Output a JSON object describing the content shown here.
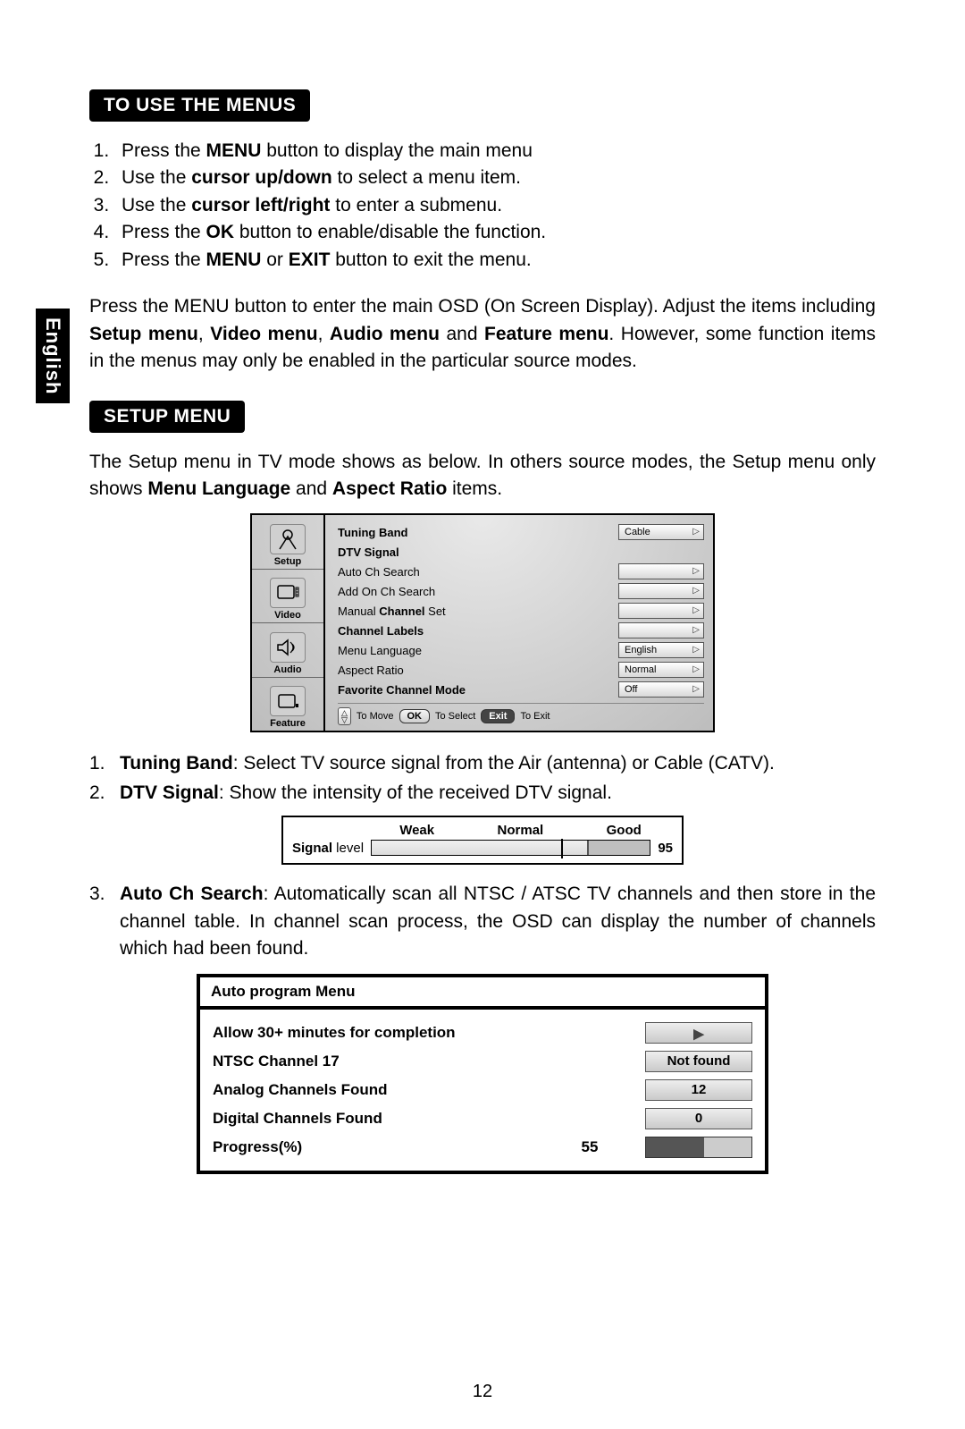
{
  "language_tab": "English",
  "heading1": "TO USE THE MENUS",
  "steps": [
    {
      "pre": "Press the ",
      "b": "MENU",
      "post": " button to display the main menu"
    },
    {
      "pre": "Use the ",
      "b": "cursor up/down",
      "post": " to select a menu item."
    },
    {
      "pre": "Use the ",
      "b": "cursor left/right",
      "post": " to enter a submenu."
    },
    {
      "pre": "Press the ",
      "b": "OK",
      "post": " button to enable/disable the function."
    },
    {
      "pre": "Press the ",
      "b": "MENU",
      "b2": "EXIT",
      "mid": " or ",
      "post": " button to exit the menu."
    }
  ],
  "para1_pre": "Press the MENU button to enter the main OSD (On Screen Display). Adjust the items including ",
  "para1_b1": "Setup menu",
  "para1_c1": ", ",
  "para1_b2": "Video menu",
  "para1_c2": ", ",
  "para1_b3": "Audio menu",
  "para1_c3": " and ",
  "para1_b4": "Feature menu",
  "para1_post": ". However, some function items in the menus may only be enabled in the particular source modes.",
  "heading2": "SETUP MENU",
  "para2_pre": "The Setup menu in TV mode shows as below. In others source modes, the Setup menu only shows ",
  "para2_b1": "Menu Language",
  "para2_mid": " and ",
  "para2_b2": "Aspect Ratio",
  "para2_post": " items.",
  "osd": {
    "tabs": [
      "Setup",
      "Video",
      "Audio",
      "Feature"
    ],
    "rows": [
      {
        "label": "Tuning Band",
        "bold": true,
        "value": "Cable"
      },
      {
        "label": "DTV Signal",
        "bold": true,
        "value": null
      },
      {
        "label": "Auto Ch Search",
        "bold": false,
        "value": ""
      },
      {
        "label": "Add On Ch Search",
        "bold": false,
        "value": ""
      },
      {
        "label": "Manual Channel Set",
        "bold": true,
        "value": ""
      },
      {
        "label": "Channel Labels",
        "bold": true,
        "value": ""
      },
      {
        "label": "Menu Language",
        "bold": false,
        "value": "English"
      },
      {
        "label": "Aspect Ratio",
        "bold": false,
        "value": "Normal"
      },
      {
        "label": "Favorite Channel Mode",
        "bold": true,
        "value": "Off"
      }
    ],
    "hints": {
      "move": "To Move",
      "ok": "OK",
      "select": "To Select",
      "exit_btn": "Exit",
      "exit": "To Exit"
    }
  },
  "desc1_num": "1.",
  "desc1_b": "Tuning Band",
  "desc1_txt": ": Select TV source signal from the Air (antenna) or Cable (CATV).",
  "desc2_num": "2.",
  "desc2_b": "DTV Signal",
  "desc2_txt": ": Show the intensity of the received DTV signal.",
  "signal": {
    "weak": "Weak",
    "normal": "Normal",
    "good": "Good",
    "label_b": "Signal",
    "label": " level",
    "value": "95"
  },
  "desc3_num": "3.",
  "desc3_b": "Auto Ch Search",
  "desc3_txt": ": Automatically scan all NTSC / ATSC TV channels and then store in the channel table. In channel scan process, the OSD can display the number of channels which had been found.",
  "apm": {
    "title": "Auto program Menu",
    "allow": "Allow 30+ minutes for completion",
    "ntsc": "NTSC Channel 17",
    "ntsc_status": "Not found",
    "analog": "Analog Channels Found",
    "analog_val": "12",
    "digital": "Digital Channels Found",
    "digital_val": "0",
    "progress": "Progress(%)",
    "progress_val": "55"
  },
  "page_number": "12"
}
